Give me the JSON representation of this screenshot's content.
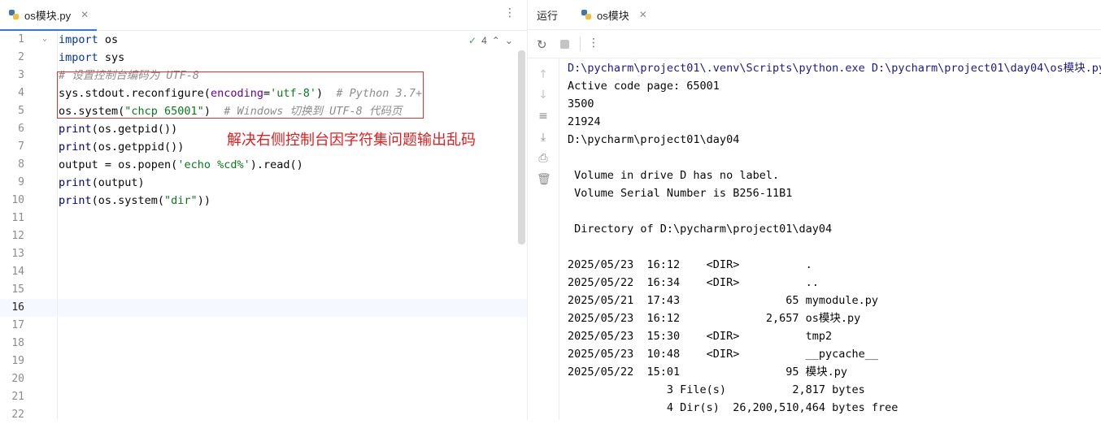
{
  "editor": {
    "tab_label": "os模块.py",
    "inspection_count": "4",
    "line_numbers": [
      "1",
      "2",
      "3",
      "4",
      "5",
      "6",
      "7",
      "8",
      "9",
      "10",
      "11",
      "12",
      "13",
      "14",
      "15",
      "16",
      "17",
      "18",
      "19",
      "20",
      "21",
      "22"
    ],
    "code": {
      "l1_kw": "import",
      "l1_rest": " os",
      "l2_kw": "import",
      "l2_rest": " sys",
      "l3_comment": "# 设置控制台编码为 UTF-8",
      "l4_a": "sys.stdout.reconfigure(",
      "l4_param": "encoding",
      "l4_eq": "=",
      "l4_str": "'utf-8'",
      "l4_close": ")",
      "l4_comment": "  # Python 3.7+",
      "l5_a": "os.system(",
      "l5_str": "\"chcp 65001\"",
      "l5_close": ")",
      "l5_comment": "  # Windows 切换到 UTF-8 代码页",
      "l6_fn": "print",
      "l6_rest": "(os.getpid())",
      "l7_fn": "print",
      "l7_rest": "(os.getppid())",
      "l8_a": "output = os.popen(",
      "l8_str": "'echo %cd%'",
      "l8_b": ").read()",
      "l9_fn": "print",
      "l9_rest": "(output)",
      "l10_fn": "print",
      "l10_a": "(os.system(",
      "l10_str": "\"dir\"",
      "l10_b": "))"
    },
    "annotation": "解决右侧控制台因字符集问题输出乱码"
  },
  "run": {
    "tool_label": "运行",
    "tab_label": "os模块",
    "output": [
      "D:\\pycharm\\project01\\.venv\\Scripts\\python.exe D:\\pycharm\\project01\\day04\\os模块.py",
      "Active code page: 65001",
      "3500",
      "21924",
      "D:\\pycharm\\project01\\day04",
      "",
      " Volume in drive D has no label.",
      " Volume Serial Number is B256-11B1",
      "",
      " Directory of D:\\pycharm\\project01\\day04",
      "",
      "2025/05/23  16:12    <DIR>          .",
      "2025/05/22  16:34    <DIR>          ..",
      "2025/05/21  17:43                65 mymodule.py",
      "2025/05/23  16:12             2,657 os模块.py",
      "2025/05/23  15:30    <DIR>          tmp2",
      "2025/05/23  10:48    <DIR>          __pycache__",
      "2025/05/22  15:01                95 模块.py",
      "               3 File(s)          2,817 bytes",
      "               4 Dir(s)  26,200,510,464 bytes free"
    ]
  },
  "icons": [
    "python-file-icon",
    "more-icon",
    "close-icon",
    "check-icon",
    "chevron-up-icon",
    "chevron-down-icon",
    "rerun-icon",
    "stop-icon",
    "arrow-up-icon",
    "arrow-down-icon",
    "soft-wrap-icon",
    "scroll-end-icon",
    "print-icon",
    "trash-icon"
  ],
  "colors": {
    "accent": "#3574f0",
    "annotation": "#e02020",
    "keyword": "#0033b3",
    "string": "#067d17",
    "comment": "#8c8c8c"
  }
}
